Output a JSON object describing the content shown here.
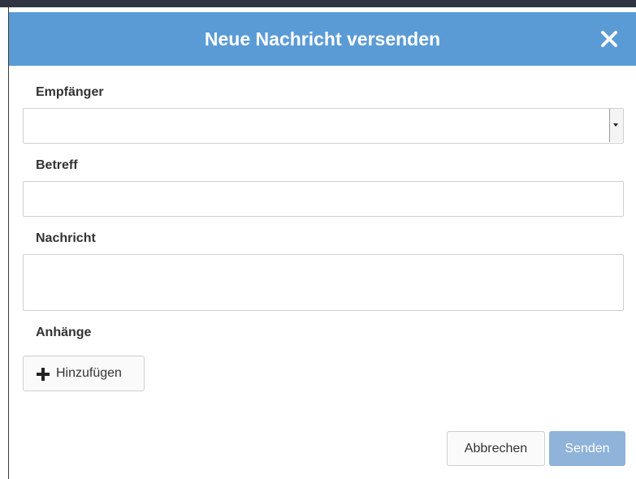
{
  "dialog": {
    "title": "Neue Nachricht versenden",
    "close_icon": "close-icon",
    "header_color": "#5b9bd5"
  },
  "form": {
    "recipient": {
      "label": "Empfänger",
      "value": ""
    },
    "subject": {
      "label": "Betreff",
      "value": ""
    },
    "message": {
      "label": "Nachricht",
      "value": ""
    },
    "attachments": {
      "label": "Anhänge",
      "add_label": "Hinzufügen",
      "add_icon": "plus-icon"
    }
  },
  "footer": {
    "cancel_label": "Abbrechen",
    "send_label": "Senden",
    "send_color": "#8fb3d9"
  }
}
